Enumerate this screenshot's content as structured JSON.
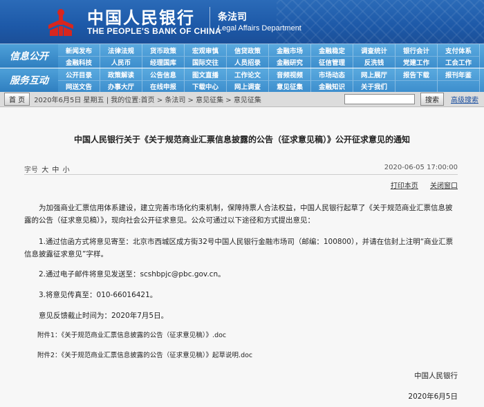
{
  "header": {
    "bank_cn": "中国人民银行",
    "bank_en": "THE PEOPLE'S BANK OF CHINA",
    "dept_cn": "条法司",
    "dept_en": "Legal Affairs Department"
  },
  "nav": {
    "block1_label": "信息公开",
    "block1_rows": [
      [
        "新闻发布",
        "法律法规",
        "货币政策",
        "宏观审慎",
        "信贷政策",
        "金融市场",
        "金融稳定",
        "调查统计",
        "银行会计",
        "支付体系"
      ],
      [
        "金融科技",
        "人民币",
        "经理国库",
        "国际交往",
        "人员招录",
        "金融研究",
        "征信管理",
        "反洗钱",
        "党建工作",
        "工会工作"
      ]
    ],
    "block2_label": "服务互动",
    "block2_rows": [
      [
        "公开目录",
        "政策解读",
        "公告信息",
        "图文直播",
        "工作论文",
        "音频视频",
        "市场动态",
        "网上展厅",
        "报告下载",
        "报刊年鉴"
      ],
      [
        "网送文告",
        "办事大厅",
        "在线申报",
        "下载中心",
        "网上调查",
        "意见征集",
        "金融知识",
        "关于我们",
        "",
        ""
      ]
    ]
  },
  "crumb": {
    "home": "首 页",
    "text": "2020年6月5日 星期五 | 我的位置:首页 > 条法司 > 意见征集 > 意见征集",
    "search_btn": "搜索",
    "adv": "高级搜索"
  },
  "article": {
    "title": "中国人民银行关于《关于规范商业汇票信息披露的公告（征求意见稿）》公开征求意见的通知",
    "fontsize_label": "字号",
    "fontsize_big": "大",
    "fontsize_mid": "中",
    "fontsize_small": "小",
    "date": "2020-06-05 17:00:00",
    "print": "打印本页",
    "close": "关闭窗口",
    "p1": "为加强商业汇票信用体系建设，建立完善市场化约束机制，保障持票人合法权益，中国人民银行起草了《关于规范商业汇票信息披露的公告（征求意见稿）》，现向社会公开征求意见。公众可通过以下途径和方式提出意见：",
    "p2": "1.通过信函方式将意见寄至：北京市西城区成方街32号中国人民银行金融市场司（邮编：100800），并请在信封上注明“商业汇票信息披露征求意见”字样。",
    "p3": "2.通过电子邮件将意见发送至：scshbpjc@pbc.gov.cn。",
    "p4": "3.将意见传真至：010-66016421。",
    "p5": "意见反馈截止时间为：2020年7月5日。",
    "att1": "附件1：《关于规范商业汇票信息披露的公告（征求意见稿）》.doc",
    "att2": "附件2：《关于规范商业汇票信息披露的公告（征求意见稿）》起草说明.doc",
    "sign_org": "中国人民银行",
    "sign_date": "2020年6月5日"
  }
}
